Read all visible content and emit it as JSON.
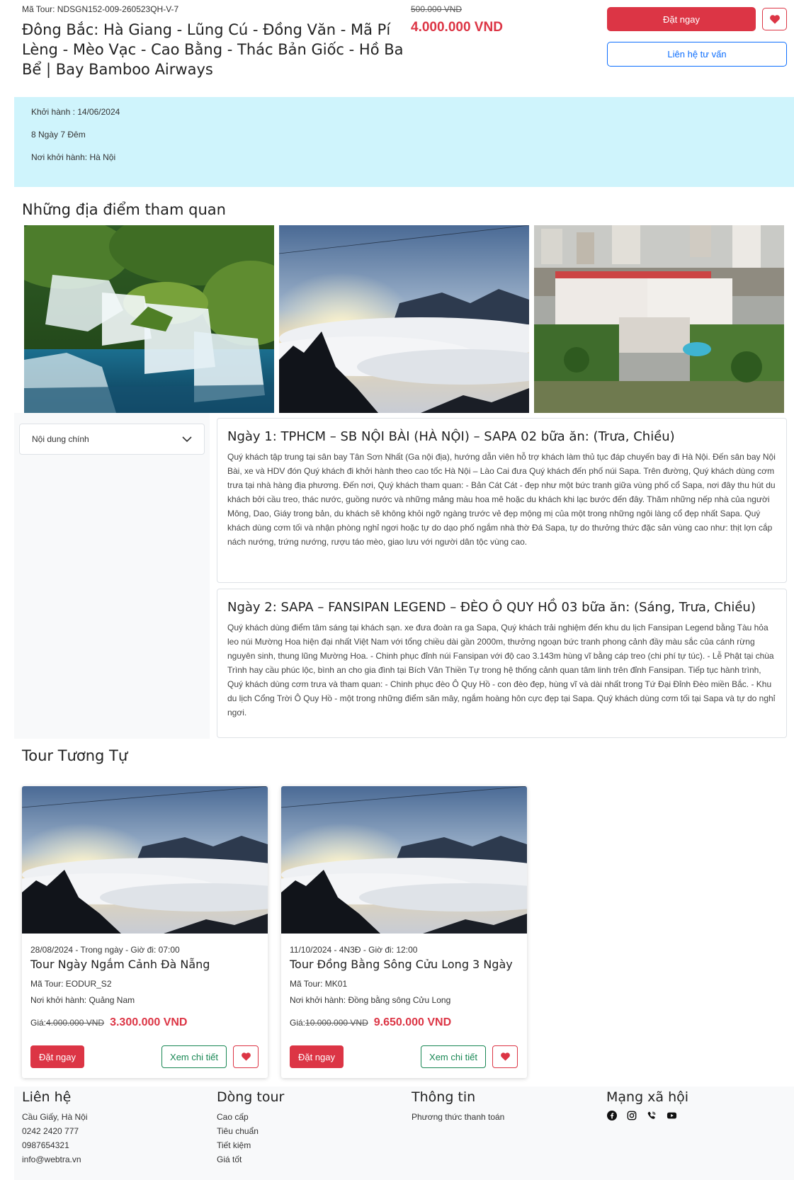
{
  "header": {
    "tour_code": "Mã Tour: NDSGN152-009-260523QH-V-7",
    "title": "Đông Bắc: Hà Giang - Lũng Cú - Đồng Văn - Mã Pí Lèng - Mèo Vạc - Cao Bằng - Thác Bản Giốc - Hồ Ba Bể | Bay Bamboo Airways",
    "old_price": "500.000 VND",
    "price": "4.000.000 VND",
    "book_label": "Đặt ngay",
    "consult_label": "Liên hệ tư vấn"
  },
  "info": {
    "departure_date": "Khởi hành : 14/06/2024",
    "duration": "8 Ngày 7 Đêm",
    "departure_place": "Nơi khởi hành: Hà Nội"
  },
  "attractions_title": "Những địa điểm tham quan",
  "sidebar": {
    "dropdown_label": "Nội dung chính"
  },
  "itinerary": [
    {
      "title": "Ngày 1: TPHCM – SB NỘI BÀI (HÀ NỘI) – SAPA 02 bữa ăn: (Trưa, Chiều)",
      "description": "Quý khách tập trung tại sân bay Tân Sơn Nhất (Ga nội địa), hướng dẫn viên hỗ trợ khách làm thủ tục đáp chuyến bay đi Hà Nội. Đến sân bay Nội Bài, xe và HDV đón Quý khách đi khởi hành theo cao tốc Hà Nội – Lào Cai đưa Quý khách đến phố núi Sapa. Trên đường, Quý khách dùng cơm trưa tại nhà hàng địa phương. Đến nơi, Quý khách tham quan: - Bản Cát Cát - đẹp như một bức tranh giữa vùng phố cổ Sapa, nơi đây thu hút du khách bởi cầu treo, thác nước, guồng nước và những mảng màu hoa mê hoặc du khách khi lạc bước đến đây. Thăm những nếp nhà của người Mông, Dao, Giáy trong bản, du khách sẽ không khỏi ngỡ ngàng trước vẻ đẹp mộng mị của một trong những ngôi làng cổ đẹp nhất Sapa. Quý khách dùng cơm tối và nhận phòng nghỉ ngơi hoặc tự do dạo phố ngắm nhà thờ Đá Sapa, tự do thưởng thức đặc sản vùng cao như: thịt lợn cắp nách nướng, trứng nướng, rượu táo mèo, giao lưu với người dân tộc vùng cao."
    },
    {
      "title": "Ngày 2: SAPA – FANSIPAN LEGEND – ĐÈO Ô QUY HỒ 03 bữa ăn: (Sáng, Trưa, Chiều)",
      "description": "Quý khách dùng điểm tâm sáng tại khách sạn. xe đưa đoàn ra ga Sapa, Quý khách trải nghiệm đến khu du lịch Fansipan Legend bằng Tàu hỏa leo núi Mường Hoa hiện đại nhất Việt Nam với tổng chiều dài gần 2000m, thưởng ngoạn bức tranh phong cảnh đầy màu sắc của cánh rừng nguyên sinh, thung lũng Mường Hoa. - Chinh phục đỉnh núi Fansipan với độ cao 3.143m hùng vĩ bằng cáp treo (chi phí tự túc). - Lễ Phật tại chùa Trình hay cầu phúc lộc, bình an cho gia đình tại Bích Vân Thiền Tự trong hệ thống cảnh quan tâm linh trên đỉnh Fansipan. Tiếp tục hành trình, Quý khách dùng cơm trưa và tham quan: - Chinh phục đèo Ô Quy Hồ - con đèo đẹp, hùng vĩ và dài nhất trong Tứ Đại Đỉnh Đèo miền Bắc. - Khu du lịch Cổng Trời Ô Quy Hồ - một trong những điểm săn mây, ngắm hoàng hôn cực đẹp tại Sapa. Quý khách dùng cơm tối tại Sapa và tự do nghỉ ngơi."
    }
  ],
  "similar": {
    "title": "Tour Tương Tự",
    "cards": [
      {
        "meta": "28/08/2024 - Trong ngày - Giờ đi: 07:00",
        "name": "Tour Ngày Ngắm Cảnh Đà Nẵng",
        "code": "Mã Tour: EODUR_S2",
        "from": "Nơi khởi hành: Quảng Nam",
        "price_label": "Giá:",
        "old_price": "4.000.000 VND",
        "price": "3.300.000 VND",
        "book_label": "Đặt ngay",
        "detail_label": "Xem chi tiết"
      },
      {
        "meta": "11/10/2024 - 4N3Đ - Giờ đi: 12:00",
        "name": "Tour Đồng Bằng Sông Cửu Long 3 Ngày",
        "code": "Mã Tour: MK01",
        "from": "Nơi khởi hành: Đồng bằng sông Cửu Long",
        "price_label": "Giá:",
        "old_price": "10.000.000 VND",
        "price": "9.650.000 VND",
        "book_label": "Đặt ngay",
        "detail_label": "Xem chi tiết"
      }
    ]
  },
  "footer": {
    "contact": {
      "title": "Liên hệ",
      "items": [
        "Cầu Giấy, Hà Nội",
        "0242 2420 777",
        "0987654321",
        "info@webtra.vn"
      ]
    },
    "tour_lines": {
      "title": "Dòng tour",
      "items": [
        "Cao cấp",
        "Tiêu chuẩn",
        "Tiết kiệm",
        "Giá tốt"
      ]
    },
    "information": {
      "title": "Thông tin",
      "items": [
        "Phương thức thanh toán"
      ]
    },
    "social": {
      "title": "Mạng xã hội",
      "icons": [
        "facebook-icon",
        "instagram-icon",
        "viber-icon",
        "youtube-icon"
      ]
    }
  },
  "colors": {
    "accent_red": "#dc3545",
    "link_blue": "#0d6efd",
    "success_green": "#198754",
    "info_bg": "#cff4fc"
  }
}
